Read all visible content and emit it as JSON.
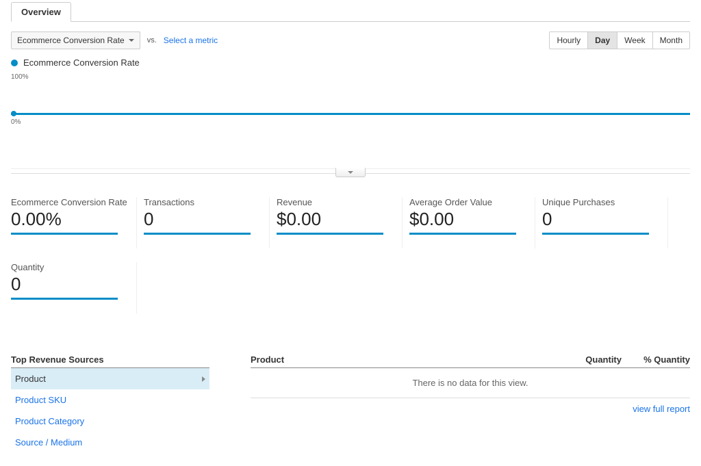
{
  "tab": {
    "overview": "Overview"
  },
  "controls": {
    "metric_selected": "Ecommerce Conversion Rate",
    "vs_label": "vs.",
    "select_metric": "Select a metric",
    "time": {
      "hourly": "Hourly",
      "day": "Day",
      "week": "Week",
      "month": "Month"
    }
  },
  "legend": {
    "series_name": "Ecommerce Conversion Rate"
  },
  "chart": {
    "y_max": "100%",
    "y_min": "0%"
  },
  "chart_data": {
    "type": "line",
    "title": "Ecommerce Conversion Rate",
    "xlabel": "",
    "ylabel": "Ecommerce Conversion Rate",
    "ylim": [
      0,
      100
    ],
    "categories": [],
    "series": [
      {
        "name": "Ecommerce Conversion Rate",
        "values": [
          0
        ]
      }
    ]
  },
  "cards": [
    {
      "label": "Ecommerce Conversion Rate",
      "value": "0.00%"
    },
    {
      "label": "Transactions",
      "value": "0"
    },
    {
      "label": "Revenue",
      "value": "$0.00"
    },
    {
      "label": "Average Order Value",
      "value": "$0.00"
    },
    {
      "label": "Unique Purchases",
      "value": "0"
    },
    {
      "label": "Quantity",
      "value": "0"
    }
  ],
  "sources": {
    "header": "Top Revenue Sources",
    "items": [
      "Product",
      "Product SKU",
      "Product Category",
      "Source / Medium"
    ]
  },
  "table": {
    "col_product": "Product",
    "col_quantity": "Quantity",
    "col_pct_quantity": "% Quantity",
    "empty": "There is no data for this view.",
    "view_full": "view full report"
  }
}
